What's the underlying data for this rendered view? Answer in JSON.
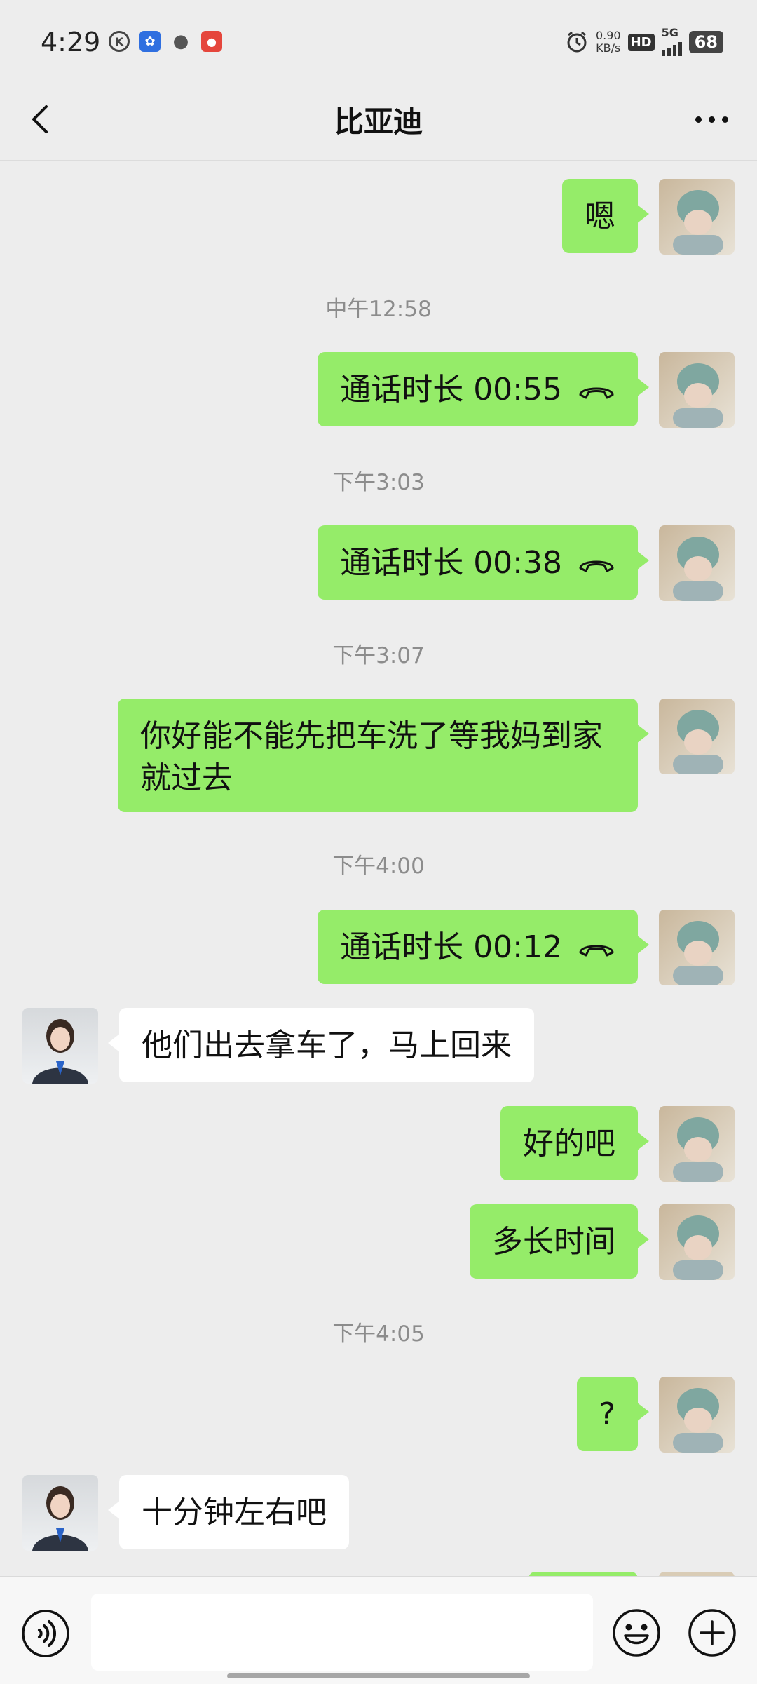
{
  "status_bar": {
    "time": "4:29",
    "speed_value": "0.90",
    "speed_unit": "KB/s",
    "hd": "HD",
    "network": "5G",
    "battery": "68"
  },
  "header": {
    "title": "比亚迪"
  },
  "messages": [
    {
      "text": "嗯"
    },
    {
      "timestamp": "中午12:58"
    },
    {
      "text": "通话时长 00:55"
    },
    {
      "timestamp": "下午3:03"
    },
    {
      "text": "通话时长 00:38"
    },
    {
      "timestamp": "下午3:07"
    },
    {
      "text": "你好能不能先把车洗了等我妈到家就过去"
    },
    {
      "timestamp": "下午4:00"
    },
    {
      "text": "通话时长 00:12"
    },
    {
      "text": "他们出去拿车了，马上回来"
    },
    {
      "text": "好的吧"
    },
    {
      "text": "多长时间"
    },
    {
      "timestamp": "下午4:05"
    },
    {
      "text": "?"
    },
    {
      "text": "十分钟左右吧"
    }
  ],
  "colors": {
    "me_bubble": "#95ec69",
    "other_bubble": "#ffffff",
    "background": "#ededed"
  }
}
